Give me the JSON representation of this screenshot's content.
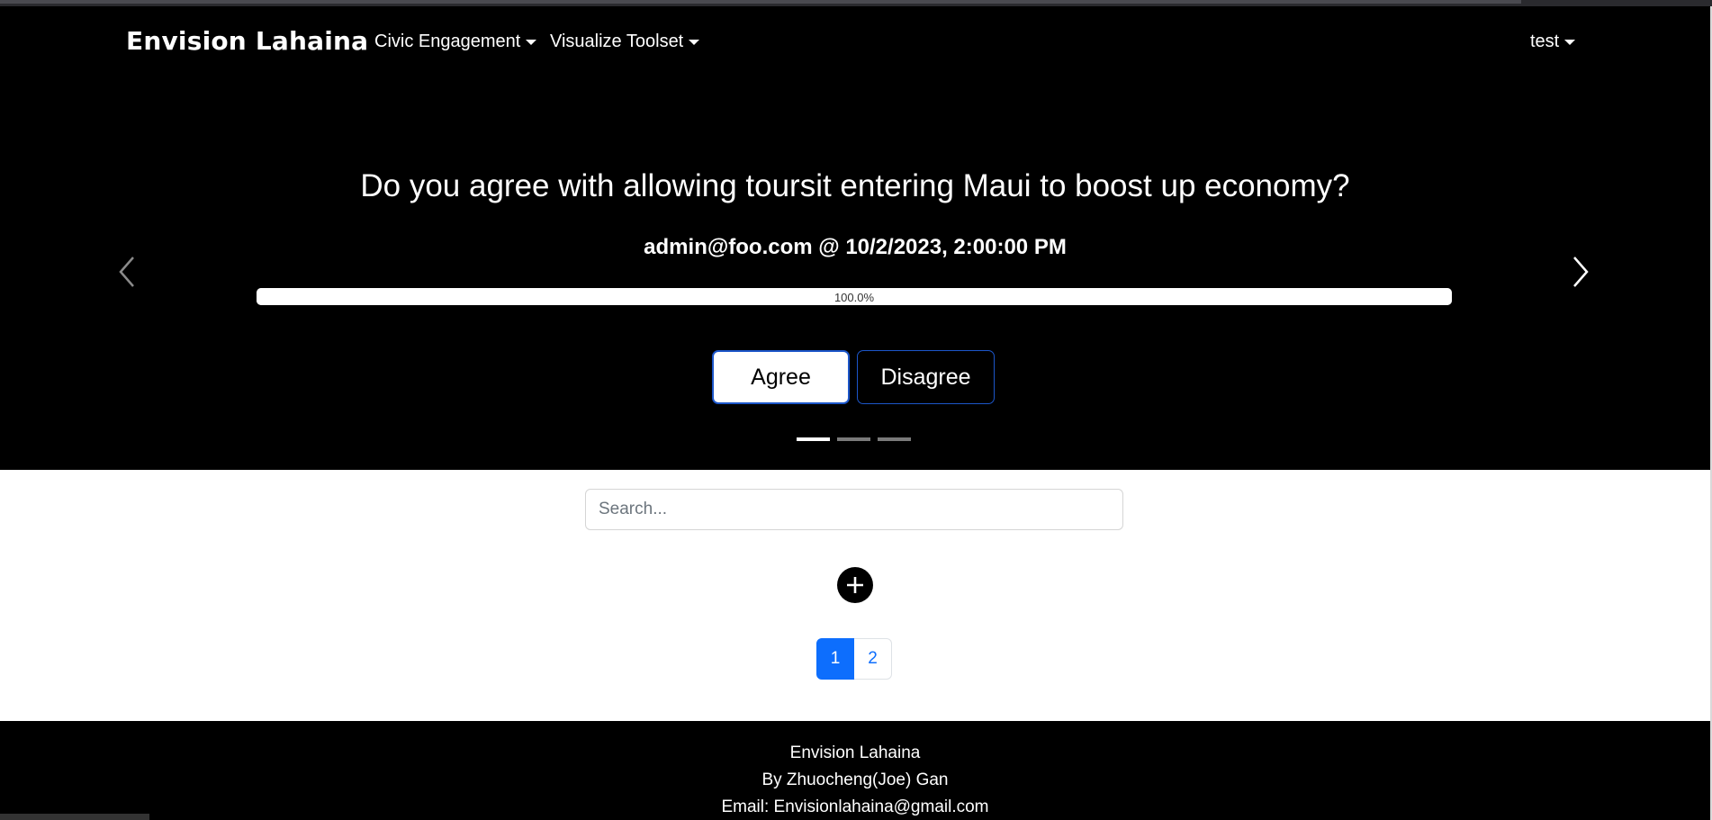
{
  "nav": {
    "brand": "Envision Lahaina",
    "civic_label": "Civic Engagement",
    "visualize_label": "Visualize Toolset",
    "user_label": "test"
  },
  "carousel": {
    "question": "Do you agree with allowing toursit entering Maui to boost up economy?",
    "byline": "admin@foo.com @ 10/2/2023, 2:00:00 PM",
    "progress_value": 1.0,
    "progress_label": "100.0%",
    "agree_label": "Agree",
    "disagree_label": "Disagree",
    "slide_count": 3,
    "active_slide": 1
  },
  "search": {
    "placeholder": "Search..."
  },
  "pagination": {
    "pages": [
      "1",
      "2"
    ],
    "active_page": "1"
  },
  "footer": {
    "site_name": "Envision Lahaina",
    "author": "By Zhuocheng(Joe) Gan",
    "email": "Email: Envisionlahaina@gmail.com"
  },
  "colors": {
    "background_dark": "#000000",
    "primary": "#0d6efd",
    "button_border": "#1c56c9"
  },
  "icons": {
    "prev": "chevron-left-icon",
    "next": "chevron-right-icon",
    "add": "plus-circle-icon",
    "dropdown": "caret-down-icon"
  }
}
